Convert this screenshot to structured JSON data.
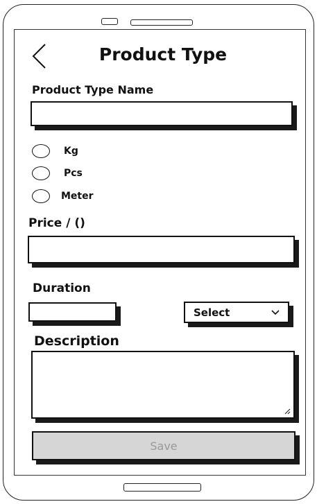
{
  "header": {
    "title": "Product Type"
  },
  "form": {
    "name_label": "Product Type Name",
    "name_value": "",
    "units": [
      {
        "label": "Kg"
      },
      {
        "label": "Pcs"
      },
      {
        "label": "Meter"
      }
    ],
    "price_label": "Price / ()",
    "price_value": "",
    "duration_label": "Duration",
    "duration_value": "",
    "duration_select": "Select",
    "description_label": "Description",
    "description_value": "",
    "save_label": "Save"
  },
  "icons": {
    "back": "chevron-left-icon",
    "select": "chevron-down-icon",
    "resize": "resize-grip-icon"
  }
}
